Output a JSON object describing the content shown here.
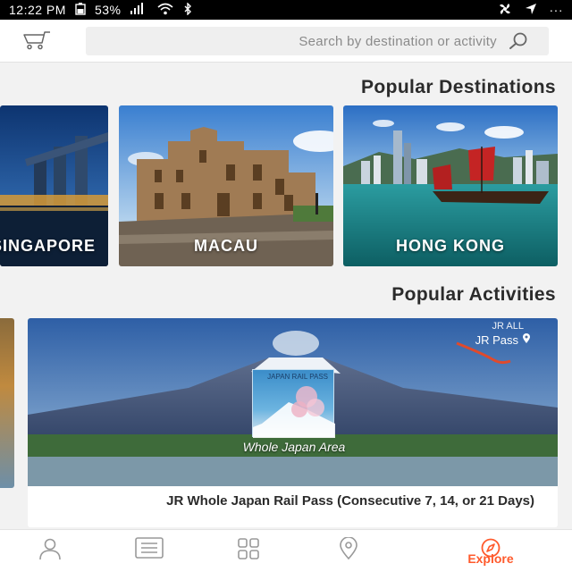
{
  "status_bar": {
    "time": "12:22 PM",
    "battery": "53%",
    "dots": "···"
  },
  "search": {
    "placeholder": "Search by destination or activity"
  },
  "sections": {
    "destinations_title": "Popular Destinations",
    "activities_title": "Popular Activities"
  },
  "destinations": [
    {
      "label": "HONG KONG"
    },
    {
      "label": "MACAU"
    },
    {
      "label": "SINGAPORE"
    }
  ],
  "activities": [
    {
      "tag": "JR Pass",
      "tag_small": "JR ALL",
      "poster_text": "JAPAN RAIL PASS",
      "caption": "Whole Japan Area",
      "title": "JR Whole Japan Rail Pass (Consecutive 7, 14, or 21 Days)"
    }
  ],
  "tabbar": {
    "explore_label": "Explore"
  },
  "colors": {
    "accent": "#ff5a2c"
  }
}
